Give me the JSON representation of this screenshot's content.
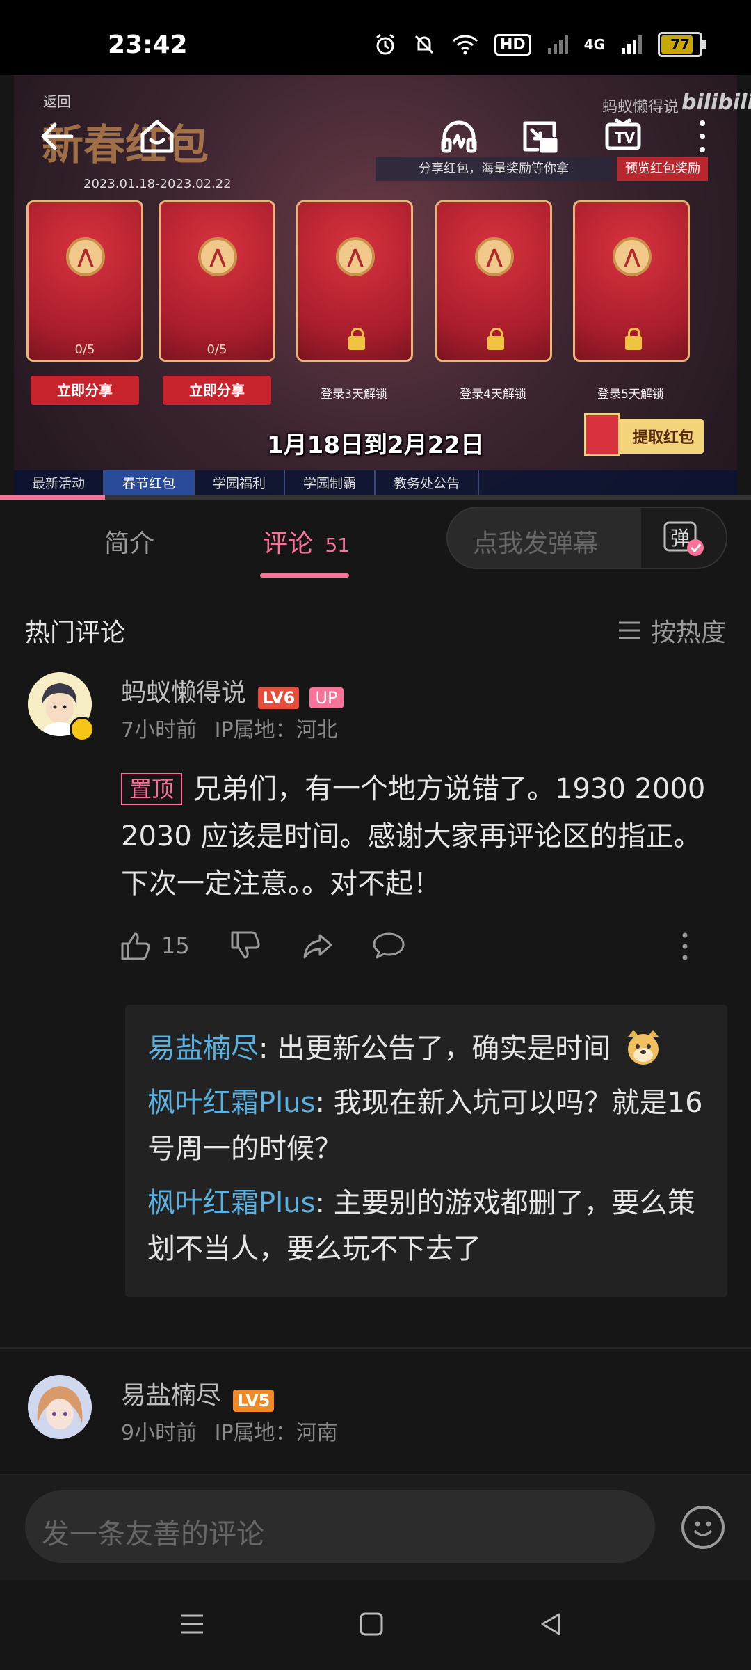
{
  "status_bar": {
    "time": "23:42",
    "hd": "HD",
    "network": "4G",
    "battery": "77"
  },
  "video": {
    "channel_watermark": "蚂蚁懒得说",
    "site_logo": "bilibili",
    "back_label": "返回",
    "event_title": "新春红包",
    "event_dates": "2023.01.18-2023.02.22",
    "share_tip": "分享红包，海量奖励等你拿",
    "preview_label": "预览红包奖励",
    "envelopes": [
      {
        "count": "0/5",
        "action": "立即分享"
      },
      {
        "count": "0/5",
        "action": "立即分享"
      },
      {
        "count": "",
        "action": "登录3天解锁"
      },
      {
        "count": "",
        "action": "登录4天解锁"
      },
      {
        "count": "",
        "action": "登录5天解锁"
      }
    ],
    "claim_label": "提取红包",
    "subtitle": "1月18日到2月22日",
    "game_tabs": [
      "最新活动",
      "春节红包",
      "学园福利",
      "学园制霸",
      "教务处公告"
    ],
    "progress": 0.14
  },
  "tabs": {
    "intro": "简介",
    "comments": "评论",
    "comments_count": "51"
  },
  "danmaku": {
    "placeholder": "点我发弹幕",
    "button_label": "弹"
  },
  "comments_header": {
    "title": "热门评论",
    "sort": "按热度"
  },
  "top_comment": {
    "user": "蚂蚁懒得说",
    "level": "LV6",
    "up_badge": "UP",
    "time": "7小时前",
    "location": "IP属地：河北",
    "pin_label": "置顶",
    "text": "兄弟们，有一个地方说错了。1930 2000 2030  应该是时间。感谢大家再评论区的指正。下次一定注意。。对不起！",
    "likes": "15"
  },
  "replies": [
    {
      "user": "易盐楠尽",
      "text": "出更新公告了，确实是时间"
    },
    {
      "user": "枫叶红霜Plus",
      "text": "我现在新入坑可以吗？就是16号周一的时候？"
    },
    {
      "user": "枫叶红霜Plus",
      "text": "主要别的游戏都删了，要么策划不当人，要么玩不下去了"
    }
  ],
  "second_comment": {
    "user": "易盐楠尽",
    "level": "LV5",
    "time": "9小时前",
    "location": "IP属地：河南"
  },
  "input": {
    "placeholder": "发一条友善的评论"
  },
  "colors": {
    "accent": "#fb7299",
    "reply_name": "#5ab0e0",
    "lv6": "#e84d3c",
    "lv5": "#f08a24"
  }
}
